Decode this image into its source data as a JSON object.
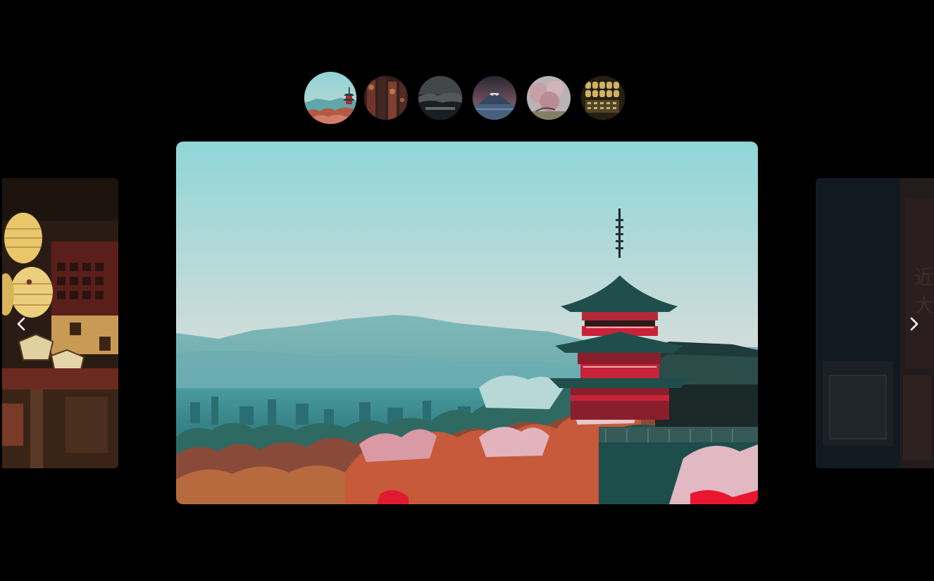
{
  "gallery": {
    "thumbnails": [
      {
        "icon": "pagoda-thumbnail-icon",
        "active": true
      },
      {
        "icon": "lantern-street-thumbnail-icon",
        "active": false
      },
      {
        "icon": "misty-hills-thumbnail-icon",
        "active": false
      },
      {
        "icon": "mount-fuji-thumbnail-icon",
        "active": false
      },
      {
        "icon": "cherry-blossom-thumbnail-icon",
        "active": false
      },
      {
        "icon": "lantern-wall-thumbnail-icon",
        "active": false
      }
    ],
    "slides": {
      "previous": {
        "icon": "lantern-alley-image"
      },
      "current": {
        "icon": "kyoto-pagoda-image"
      },
      "next": {
        "icon": "dark-signboard-image"
      }
    },
    "controls": {
      "prev_icon": "chevron-left-icon",
      "next_icon": "chevron-right-icon"
    },
    "colors": {
      "background": "#000000",
      "sky_top": "#8fd6d6",
      "sky_bottom": "#c9d6d6",
      "pagoda_red": "#c8233a",
      "foliage_orange": "#c65a3a",
      "lantern_yellow": "#e9c66a"
    }
  }
}
